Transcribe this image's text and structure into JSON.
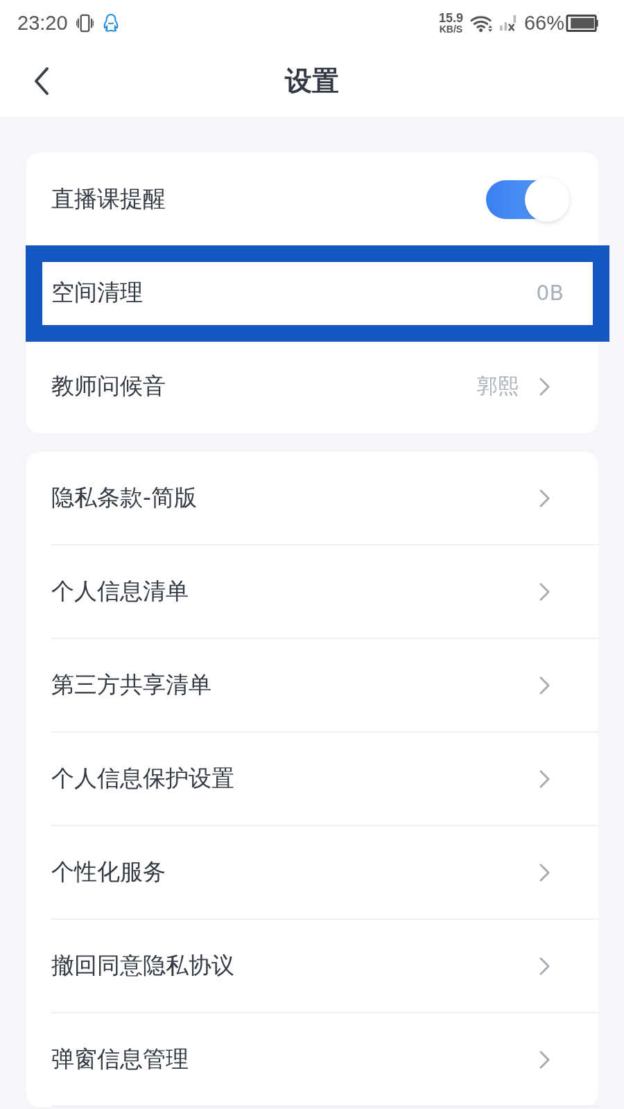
{
  "status_bar": {
    "time": "23:20",
    "net_speed": "15.9",
    "net_speed_unit": "KB/S",
    "battery": "66%"
  },
  "header": {
    "title": "设置"
  },
  "groups": [
    {
      "items": [
        {
          "kind": "toggle",
          "label": "直播课提醒",
          "on": true,
          "highlighted": false
        },
        {
          "kind": "value",
          "label": "空间清理",
          "value": "0B",
          "highlighted": true
        },
        {
          "kind": "nav",
          "label": "教师问候音",
          "value": "郭熙",
          "highlighted": false
        }
      ]
    },
    {
      "items": [
        {
          "kind": "nav",
          "label": "隐私条款-简版",
          "highlighted": false
        },
        {
          "kind": "nav",
          "label": "个人信息清单",
          "highlighted": false
        },
        {
          "kind": "nav",
          "label": "第三方共享清单",
          "highlighted": false
        },
        {
          "kind": "nav",
          "label": "个人信息保护设置",
          "highlighted": false
        },
        {
          "kind": "nav",
          "label": "个性化服务",
          "highlighted": false
        },
        {
          "kind": "nav",
          "label": "撤回同意隐私协议",
          "highlighted": false
        },
        {
          "kind": "nav",
          "label": "弹窗信息管理",
          "highlighted": false
        }
      ]
    }
  ]
}
